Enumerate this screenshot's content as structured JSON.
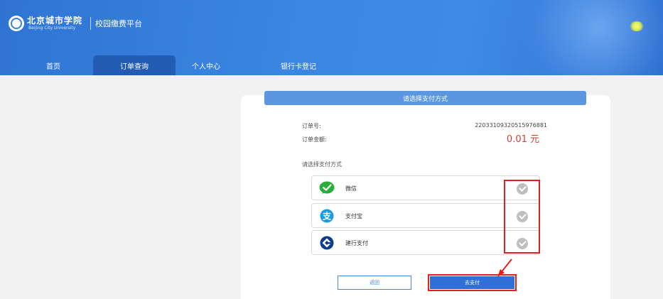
{
  "header": {
    "logo_cn": "北京城市学院",
    "logo_en": "Beijing City University",
    "platform_title": "校园缴费平台"
  },
  "nav": [
    {
      "label": "首页",
      "active": false
    },
    {
      "label": "订单查询",
      "active": true
    },
    {
      "label": "个人中心",
      "active": false
    },
    {
      "label": "银行卡登记",
      "active": false
    }
  ],
  "panel": {
    "title": "请选择支付方式",
    "order_no_label": "订单号:",
    "order_no": "22033109320515976881",
    "amount_label": "订单金额:",
    "amount": "0.01 元",
    "method_hint": "请选择支付方式"
  },
  "payment_options": [
    {
      "label": "微信",
      "icon": "wechat-icon",
      "color": "#2aae3a"
    },
    {
      "label": "支付宝",
      "icon": "alipay-icon",
      "color": "#1a9be6"
    },
    {
      "label": "建行支付",
      "icon": "ccb-icon",
      "color": "#0d3c8a"
    }
  ],
  "buttons": {
    "back": "返回",
    "pay": "去支付"
  },
  "colors": {
    "header": "#3b86e3",
    "panel_title": "#5b97e0",
    "amount": "#d43c3c",
    "highlight": "#e02020",
    "pay_button": "#2f6fd6"
  }
}
